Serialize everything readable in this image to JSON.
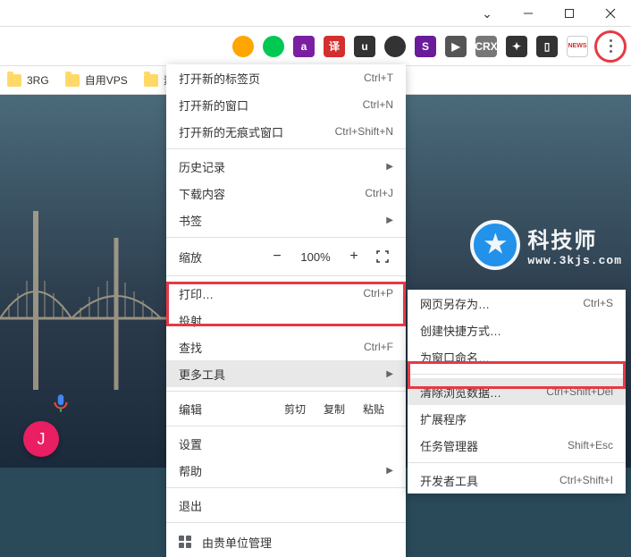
{
  "window": {
    "minimize": "–",
    "chevron": "⌄"
  },
  "toolbar_icons": [
    {
      "bg": "#ffa500",
      "txt": ""
    },
    {
      "bg": "#00c853",
      "txt": ""
    },
    {
      "bg": "#7b1fa2",
      "txt": "a"
    },
    {
      "bg": "#d32f2f",
      "txt": "译"
    },
    {
      "bg": "#333",
      "txt": "u"
    },
    {
      "bg": "#333",
      "txt": ""
    },
    {
      "bg": "#6a1b9a",
      "txt": "S"
    },
    {
      "bg": "#555",
      "txt": "▶"
    },
    {
      "bg": "#777",
      "txt": "CRX"
    },
    {
      "bg": "#333",
      "txt": "✦"
    },
    {
      "bg": "#333",
      "txt": "▯"
    },
    {
      "bg": "#fff",
      "txt": "NEWS",
      "border": "1px solid #ccc",
      "color": "#d32f2f",
      "fs": "7px"
    }
  ],
  "bookmarks": [
    {
      "label": "3RG"
    },
    {
      "label": "自用VPS"
    },
    {
      "label": "素材"
    }
  ],
  "logo": {
    "cn": "科技师",
    "en": "www.3kjs.com"
  },
  "avatar_letter": "J",
  "menu_main": {
    "group1": [
      {
        "label": "打开新的标签页",
        "shortcut": "Ctrl+T"
      },
      {
        "label": "打开新的窗口",
        "shortcut": "Ctrl+N"
      },
      {
        "label": "打开新的无痕式窗口",
        "shortcut": "Ctrl+Shift+N"
      }
    ],
    "group2": [
      {
        "label": "历史记录",
        "arrow": true
      },
      {
        "label": "下载内容",
        "shortcut": "Ctrl+J"
      },
      {
        "label": "书签",
        "arrow": true
      }
    ],
    "zoom": {
      "label": "缩放",
      "pct": "100%"
    },
    "group3": [
      {
        "label": "打印…",
        "shortcut": "Ctrl+P"
      },
      {
        "label": "投射…"
      },
      {
        "label": "查找",
        "shortcut": "Ctrl+F"
      },
      {
        "label": "更多工具",
        "arrow": true,
        "hl": true
      }
    ],
    "edit": {
      "label": "编辑",
      "cut": "剪切",
      "copy": "复制",
      "paste": "粘贴"
    },
    "group4": [
      {
        "label": "设置"
      },
      {
        "label": "帮助",
        "arrow": true
      }
    ],
    "group5": [
      {
        "label": "退出"
      }
    ],
    "footer": {
      "label": "由贵单位管理"
    }
  },
  "menu_sub": [
    {
      "label": "网页另存为…",
      "shortcut": "Ctrl+S"
    },
    {
      "label": "创建快捷方式…"
    },
    {
      "label": "为窗口命名…"
    },
    {
      "sep": true
    },
    {
      "label": "清除浏览数据…",
      "shortcut": "Ctrl+Shift+Del",
      "hl": true
    },
    {
      "label": "扩展程序"
    },
    {
      "label": "任务管理器",
      "shortcut": "Shift+Esc"
    },
    {
      "sep": true
    },
    {
      "label": "开发者工具",
      "shortcut": "Ctrl+Shift+I"
    }
  ]
}
